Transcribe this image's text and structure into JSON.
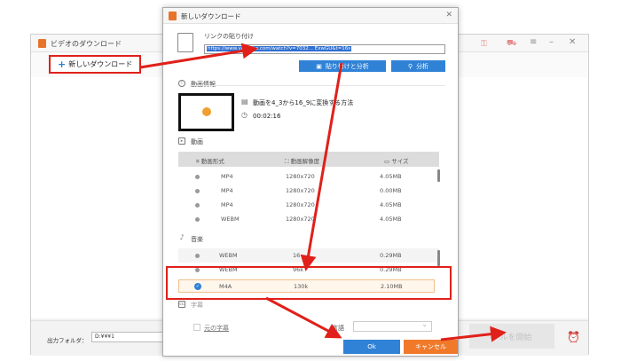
{
  "background_window": {
    "title": "ビデオのダウンロード",
    "new_download_label": "新しいダウンロード",
    "output_folder_label": "出力フォルダ：",
    "output_folder_value": "D:¥¥¥1",
    "start_download_label": "ールを開始"
  },
  "dialog": {
    "title": "新しいダウンロード",
    "link_label": "リンクの貼り付け",
    "url_value": "https://www.youtube.com/watch?v=7032... ExwGU&t=16s",
    "paste_analyze_label": "貼り付けと分析",
    "analyze_label": "分析",
    "info_section_label": "動画情報",
    "video_title": "動画を4_3から16_9に変換する方法",
    "duration": "00:02:16",
    "video_section_label": "動画",
    "columns": {
      "format": "動画形式",
      "resolution": "動画解像度",
      "size": "サイズ"
    },
    "video_rows": [
      {
        "format": "MP4",
        "resolution": "1280x720",
        "size": "4.05MB"
      },
      {
        "format": "MP4",
        "resolution": "1280x720",
        "size": "0.00MB"
      },
      {
        "format": "MP4",
        "resolution": "1280x720",
        "size": "4.05MB"
      },
      {
        "format": "WEBM",
        "resolution": "1280x720",
        "size": "4.05MB"
      }
    ],
    "audio_section_label": "音楽",
    "audio_rows": [
      {
        "format": "WEBM",
        "bitrate": "16",
        "size": "0.29MB"
      },
      {
        "format": "WEBM",
        "bitrate": "96k",
        "size": "0.29MB"
      },
      {
        "format": "M4A",
        "bitrate": "130k",
        "size": "2.10MB"
      }
    ],
    "subtitle_section_label": "字幕",
    "original_subtitle_label": "元の字幕",
    "language_label": "言語",
    "ok_label": "Ok",
    "cancel_label": "キャンセル"
  },
  "colors": {
    "accent_blue": "#2f82d6",
    "accent_orange": "#f07a2a",
    "annotation_red": "#e0201a"
  }
}
